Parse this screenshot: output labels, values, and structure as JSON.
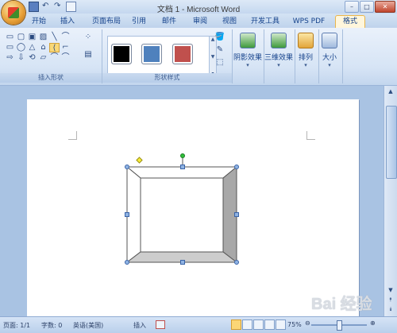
{
  "window": {
    "title": "文档 1 - Microsoft Word",
    "controls": [
      "minimize-icon",
      "maximize-icon",
      "close-icon"
    ]
  },
  "quick_access": [
    "save-icon",
    "undo-icon",
    "redo-icon",
    "print-icon"
  ],
  "tabs": [
    {
      "label": "开始"
    },
    {
      "label": "插入"
    },
    {
      "label": "页面布局"
    },
    {
      "label": "引用"
    },
    {
      "label": "邮件"
    },
    {
      "label": "审阅"
    },
    {
      "label": "视图"
    },
    {
      "label": "开发工具"
    },
    {
      "label": "WPS PDF"
    },
    {
      "label": "格式",
      "active": true
    }
  ],
  "ribbon": {
    "insert_shapes": {
      "label": "插入形状",
      "shapes": [
        "▭",
        "▢",
        "▣",
        "▨",
        "╲",
        "⌒",
        "▭",
        "◯",
        "△",
        "⌂",
        "⟨",
        "⌐",
        "⇨",
        "⇩",
        "⟲",
        "▱",
        "⌒",
        "⌒"
      ]
    },
    "shape_styles": {
      "label": "形状样式",
      "swatches": [
        {
          "color": "#000000"
        },
        {
          "color": "#4f81bd"
        },
        {
          "color": "#c0504d"
        }
      ],
      "commands": [
        "fill-icon",
        "outline-icon",
        "change-shape-icon"
      ]
    },
    "buttons": [
      {
        "label": "阴影效果",
        "icon": "shadow-icon"
      },
      {
        "label": "三维效果",
        "icon": "3d-icon"
      },
      {
        "label": "排列",
        "icon": "arrange-icon"
      },
      {
        "label": "大小",
        "icon": "size-icon"
      }
    ]
  },
  "status": {
    "page": "页面: 1/1",
    "words": "字数: 0",
    "language": "英语(美国)",
    "mode": "插入",
    "zoom": "75%",
    "zoom_level": 0.75
  },
  "watermark": "Bai 经验"
}
